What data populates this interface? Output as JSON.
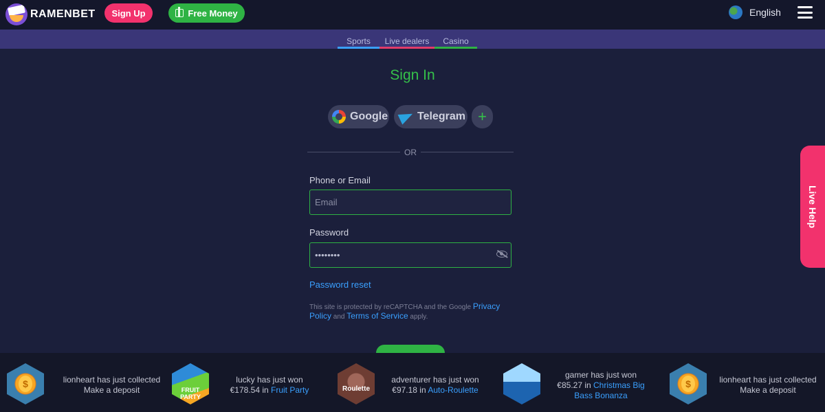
{
  "header": {
    "logo_text": "RAMENBET",
    "signup_label": "Sign Up",
    "free_money_label": "Free Money",
    "language": "English"
  },
  "tabs": [
    {
      "label": "Sports",
      "color": "#3aa0ff"
    },
    {
      "label": "Live dealers",
      "color": "#e23c6a"
    },
    {
      "label": "Casino",
      "color": "#2fb344"
    }
  ],
  "signin": {
    "title": "Sign In",
    "social": {
      "google": "Google",
      "telegram": "Telegram",
      "more": "+"
    },
    "or_text": "OR",
    "phone_label": "Phone or Email",
    "email_placeholder": "Email",
    "password_label": "Password",
    "password_value": "••••••••",
    "reset_label": "Password reset",
    "captcha": {
      "prefix": "This site is protected by reCAPTCHA and the Google ",
      "privacy": "Privacy Policy",
      "and": " and ",
      "terms": "Terms of Service",
      "suffix": " apply."
    }
  },
  "live_help": "Live Help",
  "ticker": [
    {
      "text": "lionheart has just collected Make a deposit",
      "game": ""
    },
    {
      "text": "lucky has just won €178.54 in ",
      "game": "Fruit Party",
      "thumb_label": "FRUIT PARTY"
    },
    {
      "text": "adventurer has just won €97.18 in ",
      "game": "Auto-Roulette",
      "thumb_label": "Roulette"
    },
    {
      "text": "gamer has just won €85.27 in ",
      "game": "Christmas Big Bass Bonanza"
    },
    {
      "text": "lionheart has just collected Make a deposit",
      "game": ""
    }
  ],
  "colors": {
    "accent_green": "#2fb344",
    "accent_pink": "#f2326d",
    "link_blue": "#3aa0ff"
  }
}
